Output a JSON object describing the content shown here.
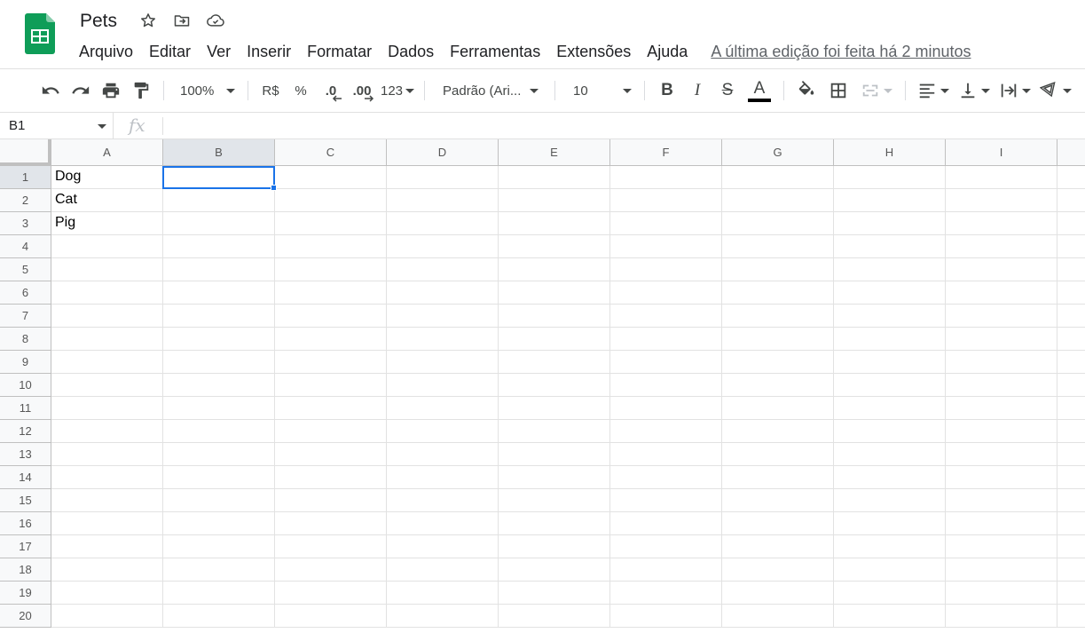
{
  "doc": {
    "title": "Pets",
    "icons": [
      "star-icon",
      "move-to-folder-icon",
      "cloud-saved-icon"
    ]
  },
  "menu": {
    "items": [
      "Arquivo",
      "Editar",
      "Ver",
      "Inserir",
      "Formatar",
      "Dados",
      "Ferramentas",
      "Extensões",
      "Ajuda"
    ],
    "last_edit": "A última edição foi feita há 2 minutos"
  },
  "toolbar": {
    "zoom": "100%",
    "currency": "R$",
    "percent": "%",
    "decrease_decimals": ".0",
    "increase_decimals": ".00",
    "more_formats": "123",
    "font": "Padrão (Ari...",
    "font_size": "10",
    "bold": "B",
    "italic": "I",
    "strike": "S",
    "text_color": "A"
  },
  "formula_bar": {
    "name_box": "B1",
    "fx": "fx",
    "content": ""
  },
  "sheet": {
    "columns": [
      "A",
      "B",
      "C",
      "D",
      "E",
      "F",
      "G",
      "H",
      "I"
    ],
    "rows": [
      "1",
      "2",
      "3",
      "4",
      "5",
      "6",
      "7",
      "8",
      "9",
      "10",
      "11",
      "12",
      "13",
      "14",
      "15",
      "16",
      "17",
      "18",
      "19",
      "20"
    ],
    "cells": {
      "A1": "Dog",
      "A2": "Cat",
      "A3": "Pig"
    },
    "selected_cell": "B1"
  },
  "colors": {
    "accent": "#1a73e8",
    "sheets_green": "#0f9d58"
  }
}
